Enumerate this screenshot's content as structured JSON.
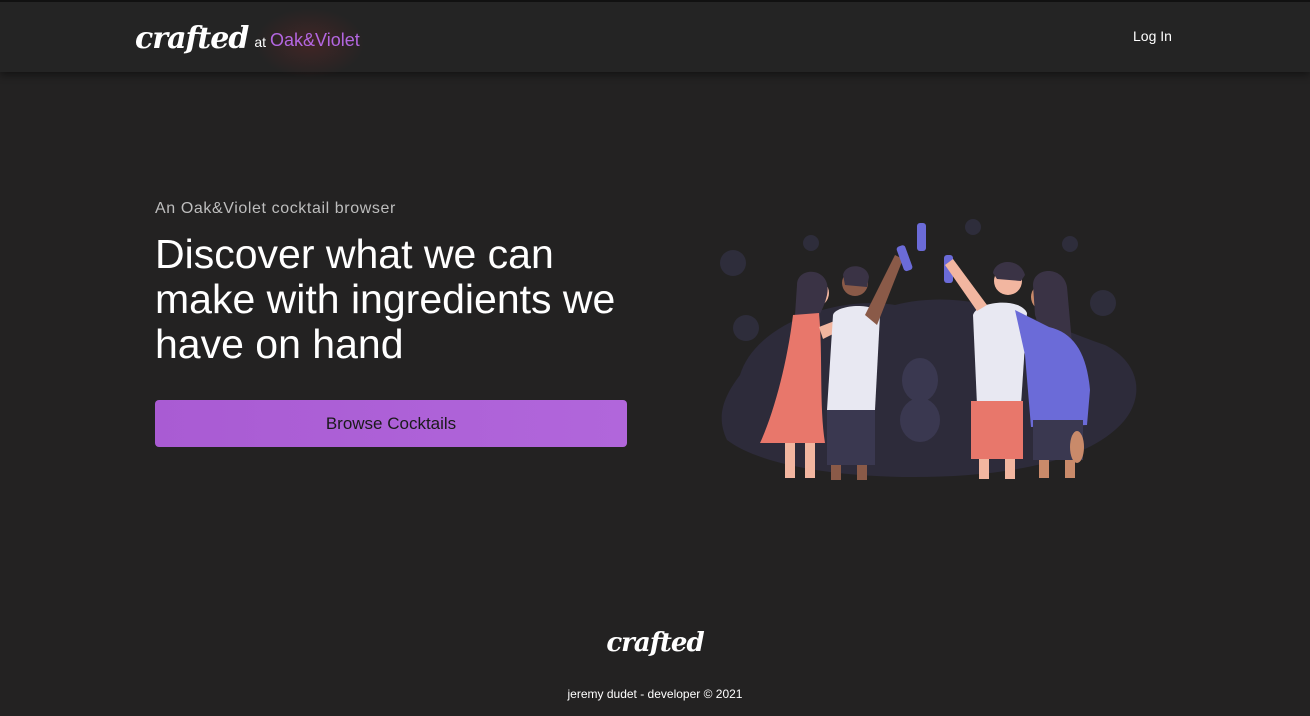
{
  "header": {
    "logo_text": "crafted",
    "at_text": "at",
    "brand_name": "Oak&Violet",
    "login_label": "Log In"
  },
  "hero": {
    "eyebrow": "An Oak&Violet cocktail browser",
    "headline": "Discover what we can make with ingredients we have on hand",
    "cta_label": "Browse Cocktails"
  },
  "illustration": {
    "icon": "friends-toasting-illustration"
  },
  "footer": {
    "logo_text": "crafted",
    "credit": "jeremy dudet - developer © 2021"
  },
  "colors": {
    "background": "#232222",
    "header_bg": "#242424",
    "accent": "#b166db",
    "muted_text": "#bdbdbd"
  }
}
